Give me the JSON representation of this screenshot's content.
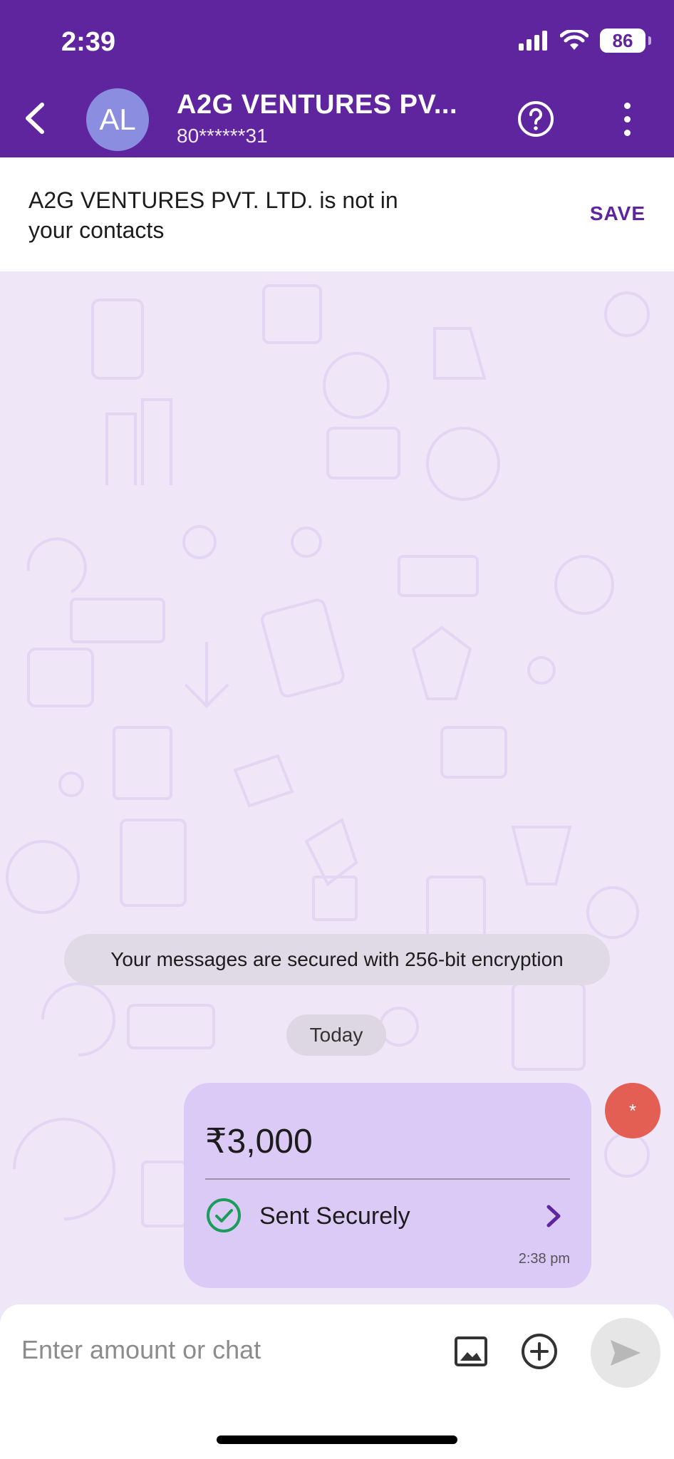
{
  "status_bar": {
    "time": "2:39",
    "battery": "86"
  },
  "header": {
    "avatar_initials": "AL",
    "contact_name": "A2G VENTURES PV...",
    "contact_number": "80******31"
  },
  "contact_banner": {
    "text": "A2G VENTURES PVT. LTD. is not in your contacts",
    "save_label": "SAVE"
  },
  "chat": {
    "encryption_notice": "Your messages are secured with 256-bit encryption",
    "date_label": "Today",
    "payment": {
      "amount": "₹3,000",
      "status": "Sent Securely",
      "time": "2:38 pm"
    },
    "badge": "*"
  },
  "input": {
    "placeholder": "Enter amount or chat"
  },
  "colors": {
    "brand": "#5f259f",
    "bubble": "#dccaf6",
    "success": "#1a9c5b",
    "badge": "#e35e53"
  },
  "icons": [
    "back-arrow-icon",
    "help-icon",
    "more-icon",
    "check-circle-icon",
    "chevron-right-icon",
    "gallery-icon",
    "plus-circle-icon",
    "send-icon",
    "signal-icon",
    "wifi-icon",
    "battery-icon"
  ]
}
